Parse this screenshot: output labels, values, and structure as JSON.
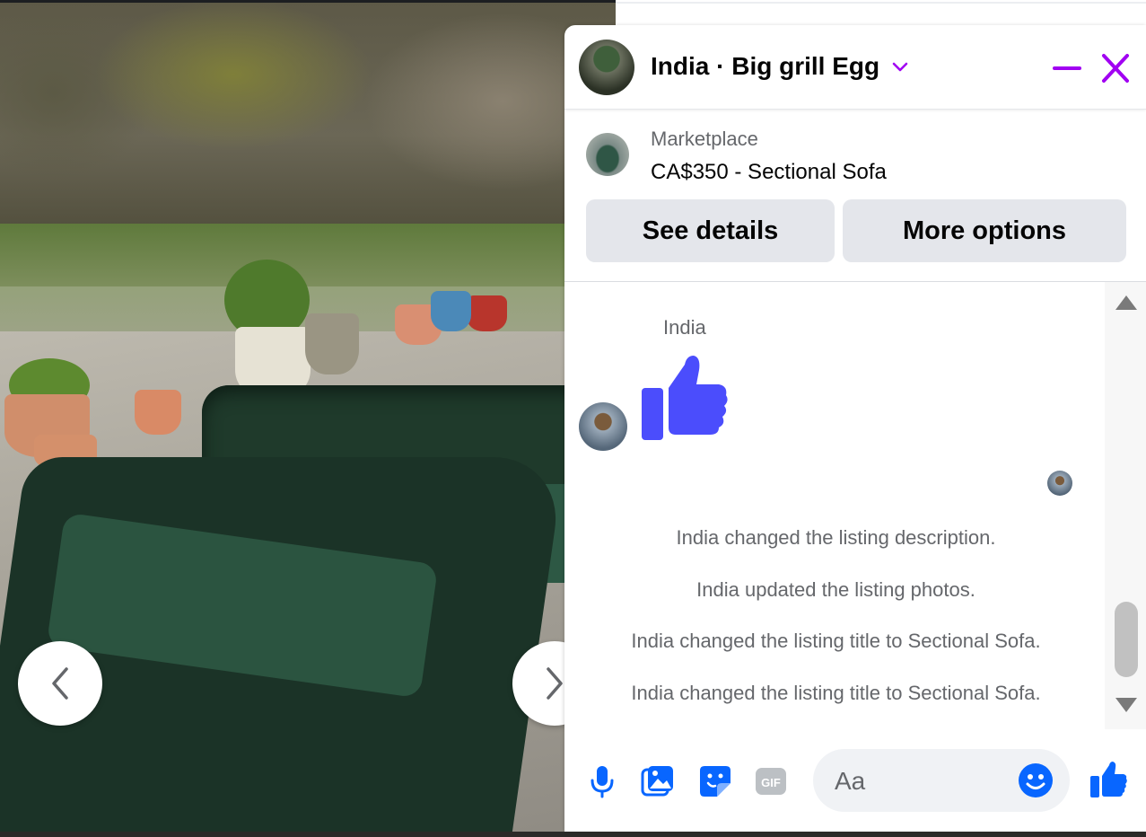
{
  "header": {
    "title": "India · Big grill Egg",
    "accent_color": "#a100f2"
  },
  "listing": {
    "source": "Marketplace",
    "title": "CA$350 - Sectional Sofa",
    "see_details_label": "See details",
    "more_options_label": "More options"
  },
  "messages": {
    "sender_name": "India",
    "sent_reaction_icon": "thumbs-up-icon",
    "reaction_color": "#4b4dfc",
    "system_messages": [
      "India changed the listing description.",
      "India updated the listing photos.",
      "India changed the listing title to Sectional Sofa.",
      "India changed the listing title to Sectional Sofa."
    ]
  },
  "composer": {
    "placeholder": "Aa",
    "icons": [
      "microphone-icon",
      "photo-icon",
      "sticker-icon",
      "gif-icon",
      "emoji-icon",
      "like-icon"
    ],
    "icon_color": "#0866ff"
  }
}
